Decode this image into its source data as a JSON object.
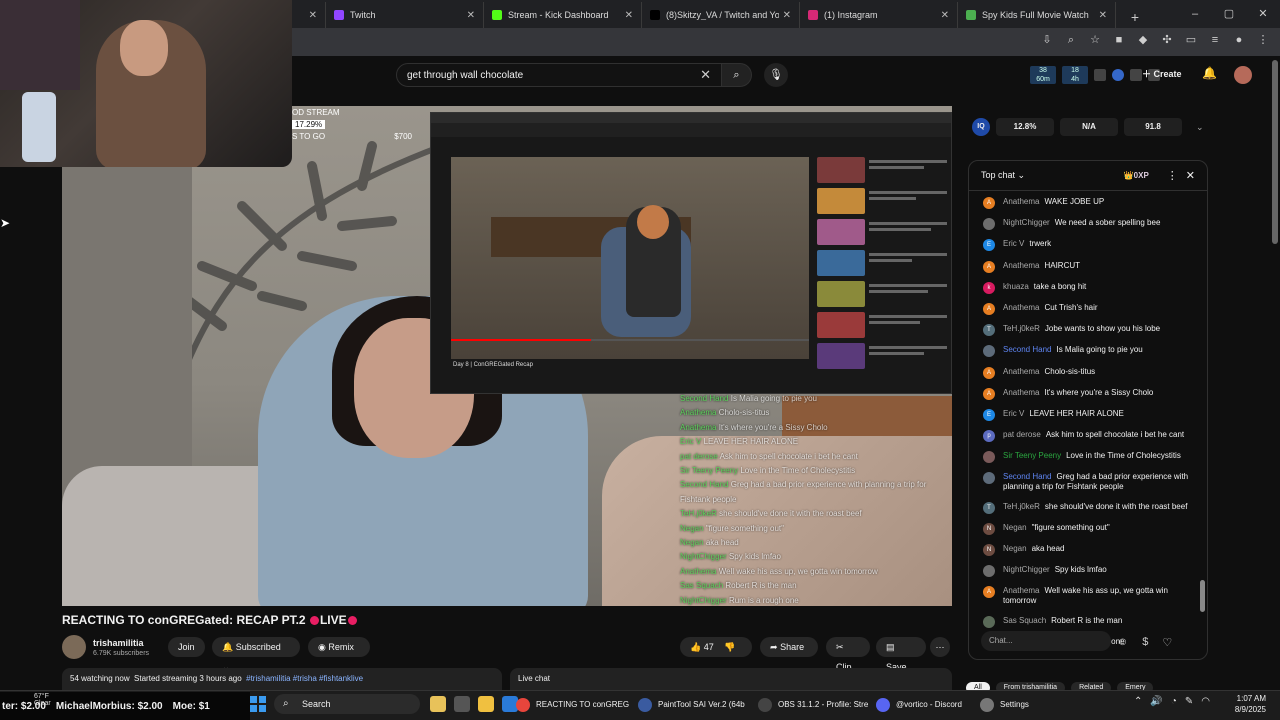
{
  "browser": {
    "tabs": [
      {
        "label": "",
        "color": "#e62117",
        "clipped": true
      },
      {
        "label": "Twitch",
        "color": "#9146ff"
      },
      {
        "label": "Stream - Kick Dashboard",
        "color": "#53fc18"
      },
      {
        "label": "(8)Skitzy_VA / Twitch and YouTu",
        "color": "#000000"
      },
      {
        "label": "(1) Instagram",
        "color": "#d62976"
      },
      {
        "label": "Spy Kids Full Movie Watch",
        "color": "#4caf50"
      }
    ],
    "new_tab": "+",
    "window_controls": [
      "–",
      "▢",
      "✕"
    ]
  },
  "youtube": {
    "search_query": "get through wall chocolate",
    "create_label": "Create",
    "extension_counts": [
      {
        "top": "38",
        "bottom": "60m"
      },
      {
        "top": "18",
        "bottom": "4h"
      }
    ],
    "video": {
      "title_text": "REACTING TO conGREGated: RECAP PT.2",
      "live_text": "LIVE",
      "channel_name": "trishamilitia",
      "subscribers": "6.79K subscribers",
      "join_label": "Join",
      "subscribed_label": "Subscribed",
      "remix_label": "Remix",
      "likes": "47",
      "share_label": "Share",
      "clip_label": "Clip",
      "save_label": "Save",
      "watching": "54 watching now",
      "started": "Started streaming 3 hours ago",
      "tags": "#trishamilitia #trisha #fishtanklive"
    },
    "live_chat_label": "Live chat",
    "overlay": {
      "stream_label": "OD STREAM",
      "percent": "17.29%",
      "goal_label": "S TO GO",
      "goal_amount": "$700"
    },
    "inner_video_title": "Day 8 | ConGREGated Recap",
    "overlay_chat": [
      {
        "user": "Second Hand",
        "text": "Is Malia going to pie you"
      },
      {
        "user": "Anathema",
        "text": "Cholo-sis-titus"
      },
      {
        "user": "Anathema",
        "text": "It's where you're a Sissy Cholo"
      },
      {
        "user": "Eric V",
        "text": "LEAVE HER HAIR ALONE"
      },
      {
        "user": "pat derose",
        "text": "Ask him to spell chocolate i bet he cant"
      },
      {
        "user": "Sir Teeny Peeny",
        "text": "Love in the Time of Cholecystitis"
      },
      {
        "user": "Second Hand",
        "text": "Greg had a bad prior experience with planning a trip for Fishtank people"
      },
      {
        "user": "TeH.j0keR",
        "text": "she should've done it with the roast beef"
      },
      {
        "user": "Negan",
        "text": "\"figure something out\""
      },
      {
        "user": "Negan",
        "text": "aka head"
      },
      {
        "user": "NightChigger",
        "text": "Spy kids lmfao"
      },
      {
        "user": "Anathema",
        "text": "Well wake his ass up, we gotta win tomorrow"
      },
      {
        "user": "Sas Squach",
        "text": "Robert R is the man"
      },
      {
        "user": "NightChigger",
        "text": "Rum is a rough one"
      }
    ]
  },
  "iq": {
    "logo": "IQ",
    "values": [
      "12.8%",
      "N/A",
      "91.8"
    ]
  },
  "chat": {
    "header_label": "Top chat",
    "xp_label": "0XP",
    "input_placeholder": "Chat...",
    "messages": [
      {
        "initial": "A",
        "color": "#e67e22",
        "user": "Anathema",
        "text": "WAKE JOBE UP",
        "role": ""
      },
      {
        "initial": "",
        "color": "#6d6d6d",
        "user": "NightChigger",
        "text": "We need a sober spelling bee",
        "role": ""
      },
      {
        "initial": "E",
        "color": "#1e88e5",
        "user": "Eric V",
        "text": "trwerk",
        "role": ""
      },
      {
        "initial": "A",
        "color": "#e67e22",
        "user": "Anathema",
        "text": "HAIRCUT",
        "role": ""
      },
      {
        "initial": "k",
        "color": "#d81b60",
        "user": "khuaza",
        "text": "take a bong hit",
        "role": ""
      },
      {
        "initial": "A",
        "color": "#e67e22",
        "user": "Anathema",
        "text": "Cut Trish's hair",
        "role": ""
      },
      {
        "initial": "T",
        "color": "#546e7a",
        "user": "TeH.j0keR",
        "text": "Jobe wants to show you his lobe",
        "role": ""
      },
      {
        "initial": "",
        "color": "#5d6b7a",
        "user": "Second Hand",
        "text": "Is Malia going to pie you",
        "role": "mod"
      },
      {
        "initial": "A",
        "color": "#e67e22",
        "user": "Anathema",
        "text": "Cholo-sis-titus",
        "role": ""
      },
      {
        "initial": "A",
        "color": "#e67e22",
        "user": "Anathema",
        "text": "It's where you're a Sissy Cholo",
        "role": ""
      },
      {
        "initial": "E",
        "color": "#1e88e5",
        "user": "Eric V",
        "text": "LEAVE HER HAIR ALONE",
        "role": ""
      },
      {
        "initial": "p",
        "color": "#5c6bc0",
        "user": "pat derose",
        "text": "Ask him to spell chocolate i bet he cant",
        "role": ""
      },
      {
        "initial": "",
        "color": "#7a5a5a",
        "user": "Sir Teeny Peeny",
        "text": "Love in the Time of Cholecystitis",
        "role": "member"
      },
      {
        "initial": "",
        "color": "#5d6b7a",
        "user": "Second Hand",
        "text": "Greg had a bad prior experience with planning a trip for Fishtank people",
        "role": "mod"
      },
      {
        "initial": "T",
        "color": "#546e7a",
        "user": "TeH.j0keR",
        "text": "she should've done it with the roast beef",
        "role": ""
      },
      {
        "initial": "N",
        "color": "#6d4c41",
        "user": "Negan",
        "text": "\"figure something out\"",
        "role": ""
      },
      {
        "initial": "N",
        "color": "#6d4c41",
        "user": "Negan",
        "text": "aka head",
        "role": ""
      },
      {
        "initial": "",
        "color": "#6d6d6d",
        "user": "NightChigger",
        "text": "Spy kids lmfao",
        "role": ""
      },
      {
        "initial": "A",
        "color": "#e67e22",
        "user": "Anathema",
        "text": "Well wake his ass up, we gotta win tomorrow",
        "role": ""
      },
      {
        "initial": "",
        "color": "#5a6a58",
        "user": "Sas Squach",
        "text": "Robert R is the man",
        "role": ""
      },
      {
        "initial": "",
        "color": "#6d6d6d",
        "user": "NightChigger",
        "text": "Rum is a rough one",
        "role": ""
      }
    ],
    "filters": [
      "All",
      "From trishamilitia",
      "Related",
      "Emery"
    ]
  },
  "ticker": [
    {
      "label": "ter: $2.00"
    },
    {
      "label": "MichaelMorbius: $2.00"
    },
    {
      "label": "Moe: $1"
    }
  ],
  "taskbar": {
    "weather_temp": "67°F",
    "weather_desc": "Clear",
    "search_label": "Search",
    "apps": [
      {
        "label": "REACTING TO conGREG",
        "color": "#e8453c"
      },
      {
        "label": "PaintTool SAI Ver.2 (64b",
        "color": "#3a5ba0"
      },
      {
        "label": "OBS 31.1.2 - Profile: Stre",
        "color": "#444444"
      },
      {
        "label": "@vortico - Discord",
        "color": "#5865f2"
      },
      {
        "label": "Settings",
        "color": "#777777"
      }
    ],
    "time": "1:07 AM",
    "date": "8/9/2025"
  }
}
